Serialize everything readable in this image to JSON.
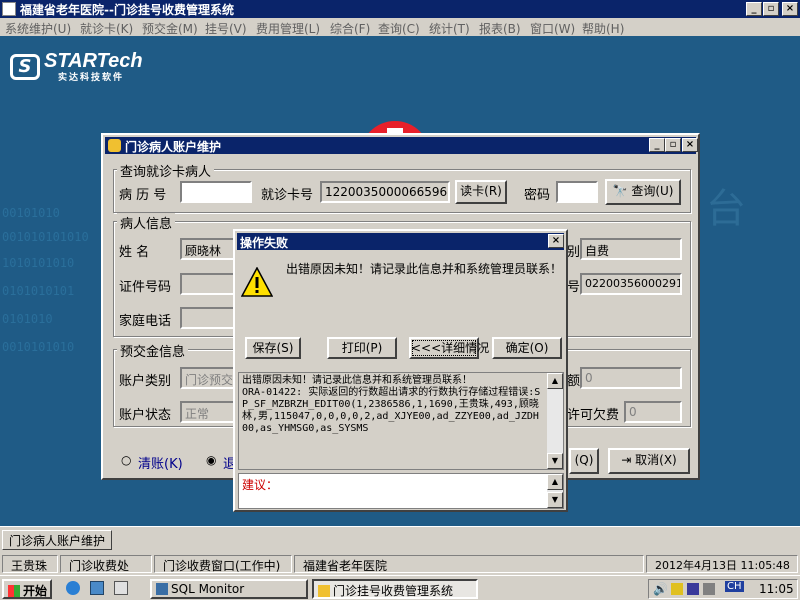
{
  "app": {
    "title": "福建省老年医院--门诊挂号收费管理系统",
    "menus": [
      "系统维护(U)",
      "就诊卡(K)",
      "预交金(M)",
      "挂号(V)",
      "费用管理(L)",
      "综合(F)",
      "查询(C)",
      "统计(T)",
      "报表(B)",
      "窗口(W)",
      "帮助(H)"
    ],
    "window_controls": [
      "_",
      "▫",
      "×"
    ]
  },
  "desktop": {
    "logo_brand": "STARTech",
    "logo_letter": "S",
    "logo_sub": "实达科技软件",
    "binary_text": [
      "00101010",
      "001010101010",
      "1010101010",
      "0101010101",
      "0101010",
      "0010101010",
      "台"
    ]
  },
  "patient_window": {
    "title": "门诊病人账户维护",
    "search_group": {
      "label": "查询就诊卡病人",
      "record_no_label": "病 历 号",
      "record_no_value": "",
      "card_no_label": "就诊卡号",
      "card_no_value": "1220035000066596",
      "read_card_button": "读卡(R)",
      "password_label": "密码",
      "password_value": "",
      "query_button": "查询(U)"
    },
    "info_group": {
      "label": "病人信息",
      "name_label": "姓    名",
      "name_value": "顾晓林",
      "category_label_partial": "别",
      "category_value": "自费",
      "id_label": "证件号码",
      "id_value": "",
      "number_label_partial": "号",
      "number_value": "02200356000291",
      "phone_label": "家庭电话",
      "phone_value": ""
    },
    "deposit_group": {
      "label": "预交金信息",
      "account_type_label": "账户类别",
      "account_type_value": "门诊预交",
      "amount_label_partial": "额",
      "amount_value": "0",
      "account_status_label": "账户状态",
      "account_status_value": "正常",
      "overdraft_label_partial": "许可欠费",
      "overdraft_value": "0"
    },
    "options": {
      "clear_label": "清账(K)",
      "refund_label_partial": "退",
      "ok_partial_label": "(Q)",
      "cancel_button": "取消(X)"
    }
  },
  "error_dialog": {
    "title": "操作失败",
    "message": "出错原因未知！请记录此信息并和系统管理员联系！",
    "buttons": {
      "save": "保存(S)",
      "print": "打印(P)",
      "details": "<<<详细情况",
      "ok": "确定(O)"
    },
    "detail_text": "出错原因未知！请记录此信息并和系统管理员联系！\nORA-01422: 实际返回的行数超出请求的行数执行存储过程错误:SP_SF_MZBRZH_EDIT00(1,2386586,1,1690,王贵珠,493,顾晓林,男,115047,0,0,0,0,2,ad_XJYE00,ad_ZZYE00,ad_JZDH00,as_YHMSG0,as_SYSMS",
    "suggestion_label": "建议："
  },
  "mdi_tab": "门诊病人账户维护",
  "status_bar": {
    "user": "王贵珠",
    "department": "门诊收费处",
    "window": "门诊收费窗口(工作中)",
    "hospital": "福建省老年医院",
    "datetime": "2012年4月13日 11:05:48"
  },
  "taskbar": {
    "start": "开始",
    "tasks": [
      "SQL Monitor",
      "门诊挂号收费管理系统"
    ],
    "tray_lang": "CH",
    "clock": "11:05"
  },
  "colors": {
    "title_bar": "#0a246a",
    "desktop": "#1f5b86",
    "face": "#d4d0c8",
    "logo_red": "#e8202a"
  }
}
